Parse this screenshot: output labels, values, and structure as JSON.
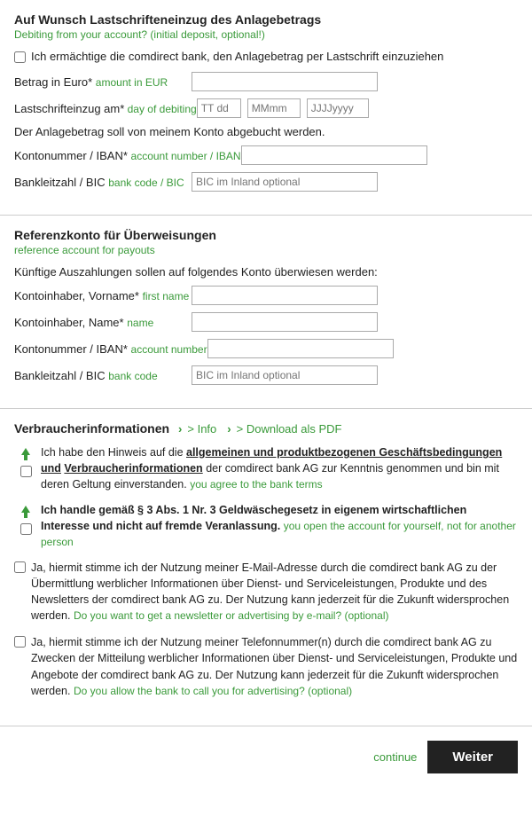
{
  "section1": {
    "title": "Auf Wunsch Lastschrifteneinzug des Anlagebetrags",
    "subtitle": "Debiting from your account? (initial deposit, optional!)",
    "checkbox_label": "Ich ermächtige die comdirect bank, den Anlagebetrag per Lastschrift einzuziehen",
    "amount_label": "Betrag in Euro*",
    "amount_label_en": "amount in EUR",
    "debit_date_label": "Lastschrifteinzug am*",
    "debit_date_label_en": "day of debiting",
    "debit_info": "Der Anlagebetrag soll von meinem Konto abgebucht werden.",
    "iban_label": "Kontonummer / IBAN*",
    "iban_label_en": "account number / IBAN",
    "bic_label": "Bankleitzahl / BIC",
    "bic_label_en": "bank code / BIC",
    "bic_placeholder": "BIC im Inland optional",
    "date_placeholder_dd": "TT dd",
    "date_placeholder_mm": "MMmm",
    "date_placeholder_yyyy": "JJJJyyyy"
  },
  "section2": {
    "title": "Referenzkonto für Überweisungen",
    "subtitle": "reference account for payouts",
    "info_text": "Künftige Auszahlungen sollen auf folgendes Konto überwiesen werden:",
    "firstname_label": "Kontoinhaber, Vorname*",
    "firstname_label_en": "first name",
    "lastname_label": "Kontoinhaber, Name*",
    "lastname_label_en": "name",
    "iban_label": "Kontonummer / IBAN*",
    "iban_label_en": "account number",
    "bic_label": "Bankleitzahl / BIC",
    "bic_label_en": "bank code",
    "bic_placeholder": "BIC im Inland optional"
  },
  "section3": {
    "title": "Verbraucherinformationen",
    "info_link": "> Info",
    "download_link": "> Download als PDF",
    "consent1_text": "Ich habe den Hinweis auf die ",
    "consent1_link1": "allgemeinen und produktbezogenen Geschäftsbedingungen und",
    "consent1_link2": "Verbraucherinformationen",
    "consent1_text2": " der comdirect bank AG zur Kenntnis genommen und bin mit deren Geltung einverstanden.",
    "consent1_en": "you agree to the bank terms",
    "consent2_bold": "Ich handle gemäß § 3 Abs. 1 Nr. 3 Geldwäschegesetz in eigenem wirtschaftlichen Interesse und nicht auf fremde Veranlassung.",
    "consent2_en": "you open the account for yourself, not for another person",
    "consent3_text": "Ja, hiermit stimme ich der Nutzung meiner E-Mail-Adresse durch die comdirect bank AG zu der Übermittlung werblicher Informationen über Dienst- und Serviceleistungen, Produkte und des Newsletters der comdirect bank AG zu. Der Nutzung kann jederzeit für die Zukunft widersprochen werden.",
    "consent3_en": "Do you want to get a newsletter or advertising by e-mail? (optional)",
    "consent4_text": "Ja, hiermit stimme ich der Nutzung meiner Telefonnummer(n) durch die comdirect bank AG zu Zwecken der Mitteilung werblicher Informationen über Dienst- und Serviceleistungen, Produkte und Angebote der comdirect bank AG zu. Der Nutzung kann jederzeit für die Zukunft widersprochen werden.",
    "consent4_en": "Do you allow the bank to call you for advertising? (optional)"
  },
  "bottom": {
    "continue_label": "continue",
    "weiter_label": "Weiter"
  }
}
